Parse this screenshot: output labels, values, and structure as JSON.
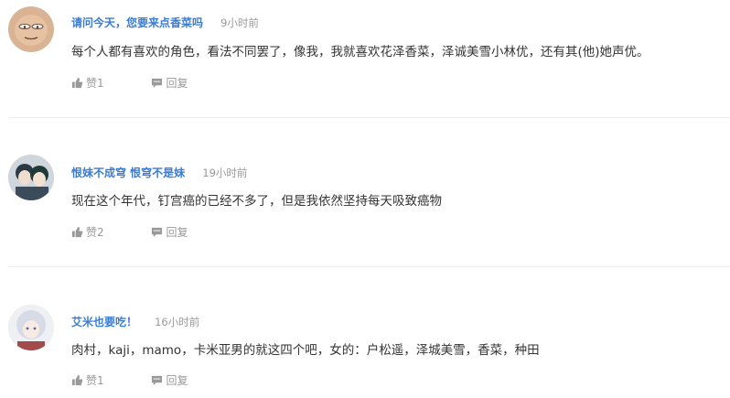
{
  "comments": [
    {
      "username": "请问今天，您要来点香菜吗",
      "time": "9小时前",
      "content": "每个人都有喜欢的角色，看法不同罢了，像我，我就喜欢花泽香菜，泽诚美雪小林优，还有其(他)她声优。",
      "like_label": "赞1",
      "reply_label": "回复"
    },
    {
      "username": "恨妹不成穹 恨穹不是妹",
      "time": "19小时前",
      "content": "现在这个年代，钉宫癌的已经不多了，但是我依然坚持每天吸致癌物",
      "like_label": "赞2",
      "reply_label": "回复"
    },
    {
      "username": "艾米也要吃！",
      "time": "16小时前",
      "content": "肉村，kaji，mamo，卡米亚男的就这四个吧，女的：户松遥，泽城美雪，香菜，种田",
      "like_label": "赞1",
      "reply_label": "回复"
    }
  ],
  "colors": {
    "username": "#3a7bd5",
    "meta": "#999999",
    "text": "#333333",
    "divider": "#eeeeee"
  }
}
